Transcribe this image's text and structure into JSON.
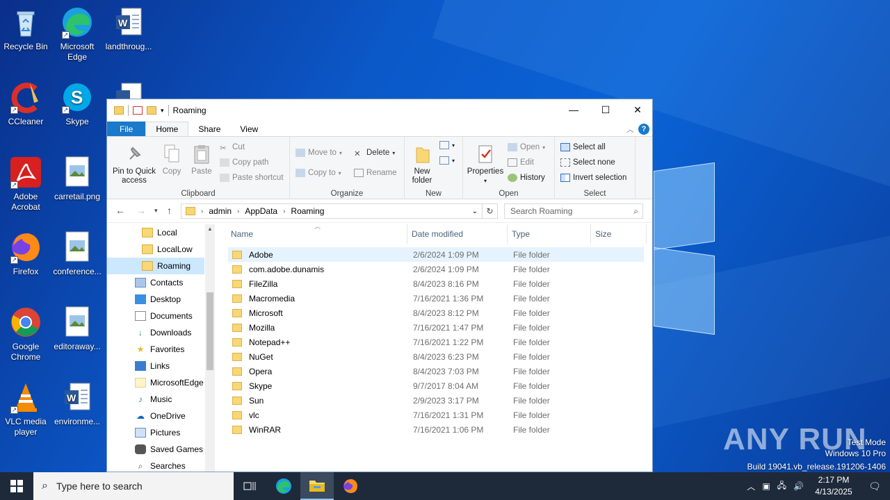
{
  "desktop": {
    "icons": [
      {
        "label": "Recycle Bin",
        "icon": "recycle-bin-icon"
      },
      {
        "label": "Microsoft Edge",
        "icon": "edge-icon"
      },
      {
        "label": "landthroug...",
        "icon": "word-doc-icon"
      },
      {
        "label": "CCleaner",
        "icon": "ccleaner-icon"
      },
      {
        "label": "Skype",
        "icon": "skype-icon"
      },
      {
        "label": "Adobe Acrobat",
        "icon": "acrobat-icon"
      },
      {
        "label": "carretail.png",
        "icon": "image-file-icon"
      },
      {
        "label": "Firefox",
        "icon": "firefox-icon"
      },
      {
        "label": "conference...",
        "icon": "image-file-icon"
      },
      {
        "label": "Google Chrome",
        "icon": "chrome-icon"
      },
      {
        "label": "editoraway...",
        "icon": "image-file-icon"
      },
      {
        "label": "VLC media player",
        "icon": "vlc-icon"
      },
      {
        "label": "environme...",
        "icon": "word-doc-icon"
      }
    ],
    "watermark": {
      "brand": "ANY RUN",
      "line1": "Test Mode",
      "line2": "Windows 10 Pro",
      "line3": "Build 19041.vb_release.191206-1406"
    }
  },
  "explorer": {
    "title": "Roaming",
    "controls": {
      "minimize": "—",
      "maximize": "☐",
      "close": "✕"
    },
    "tabs": [
      "File",
      "Home",
      "Share",
      "View"
    ],
    "ribbon": {
      "clipboard": {
        "label": "Clipboard",
        "pin": "Pin to Quick access",
        "copy": "Copy",
        "paste": "Paste",
        "cut": "Cut",
        "copy_path": "Copy path",
        "paste_shortcut": "Paste shortcut"
      },
      "organize": {
        "label": "Organize",
        "move_to": "Move to",
        "copy_to": "Copy to",
        "delete": "Delete",
        "rename": "Rename"
      },
      "new": {
        "label": "New",
        "new_folder": "New folder"
      },
      "open": {
        "label": "Open",
        "properties": "Properties",
        "open": "Open",
        "edit": "Edit",
        "history": "History"
      },
      "select": {
        "label": "Select",
        "select_all": "Select all",
        "select_none": "Select none",
        "invert": "Invert selection"
      }
    },
    "address": {
      "crumbs": [
        "admin",
        "AppData",
        "Roaming"
      ],
      "search_placeholder": "Search Roaming"
    },
    "nav_items": [
      {
        "label": "Local",
        "icon": "folder-icon"
      },
      {
        "label": "LocalLow",
        "icon": "folder-icon"
      },
      {
        "label": "Roaming",
        "icon": "folder-icon",
        "selected": true
      },
      {
        "label": "Contacts",
        "icon": "contacts-icon"
      },
      {
        "label": "Desktop",
        "icon": "desktop-icon"
      },
      {
        "label": "Documents",
        "icon": "documents-icon"
      },
      {
        "label": "Downloads",
        "icon": "downloads-icon"
      },
      {
        "label": "Favorites",
        "icon": "star-icon"
      },
      {
        "label": "Links",
        "icon": "links-icon"
      },
      {
        "label": "MicrosoftEdge",
        "icon": "folder-icon"
      },
      {
        "label": "Music",
        "icon": "music-icon"
      },
      {
        "label": "OneDrive",
        "icon": "cloud-icon"
      },
      {
        "label": "Pictures",
        "icon": "pictures-icon"
      },
      {
        "label": "Saved Games",
        "icon": "saved-games-icon"
      },
      {
        "label": "Searches",
        "icon": "search-icon"
      }
    ],
    "columns": [
      "Name",
      "Date modified",
      "Type",
      "Size"
    ],
    "files": [
      {
        "name": "Adobe",
        "date": "2/6/2024 1:09 PM",
        "type": "File folder"
      },
      {
        "name": "com.adobe.dunamis",
        "date": "2/6/2024 1:09 PM",
        "type": "File folder"
      },
      {
        "name": "FileZilla",
        "date": "8/4/2023 8:16 PM",
        "type": "File folder"
      },
      {
        "name": "Macromedia",
        "date": "7/16/2021 1:36 PM",
        "type": "File folder"
      },
      {
        "name": "Microsoft",
        "date": "8/4/2023 8:12 PM",
        "type": "File folder"
      },
      {
        "name": "Mozilla",
        "date": "7/16/2021 1:47 PM",
        "type": "File folder"
      },
      {
        "name": "Notepad++",
        "date": "7/16/2021 1:22 PM",
        "type": "File folder"
      },
      {
        "name": "NuGet",
        "date": "8/4/2023 6:23 PM",
        "type": "File folder"
      },
      {
        "name": "Opera",
        "date": "8/4/2023 7:03 PM",
        "type": "File folder"
      },
      {
        "name": "Skype",
        "date": "9/7/2017 8:04 AM",
        "type": "File folder"
      },
      {
        "name": "Sun",
        "date": "2/9/2023 3:17 PM",
        "type": "File folder"
      },
      {
        "name": "vlc",
        "date": "7/16/2021 1:31 PM",
        "type": "File folder"
      },
      {
        "name": "WinRAR",
        "date": "7/16/2021 1:06 PM",
        "type": "File folder"
      }
    ]
  },
  "taskbar": {
    "search_placeholder": "Type here to search",
    "time": "2:17 PM",
    "date": "4/13/2025"
  }
}
